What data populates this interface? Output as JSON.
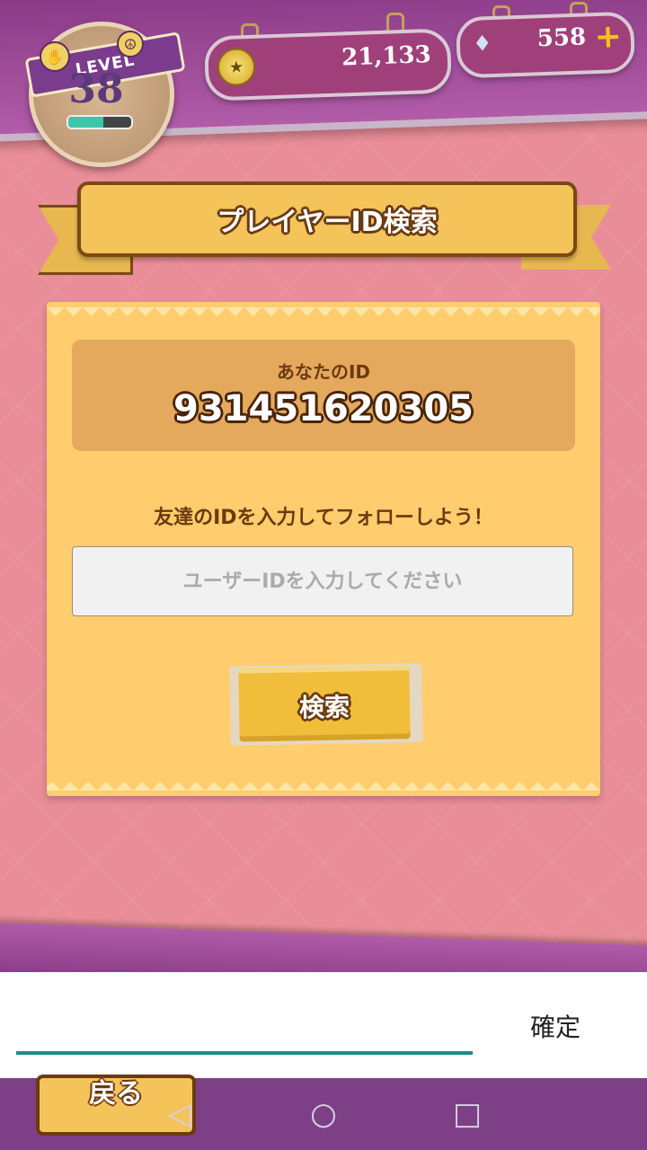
{
  "header": {
    "level_badge_text": "LEVEL",
    "level": "38",
    "level_progress": 0.55,
    "coins": "21,133",
    "gems": "558"
  },
  "banner": {
    "title": "プレイヤーID検索"
  },
  "card": {
    "id_label": "あなたのID",
    "id_value": "931451620305",
    "prompt": "友達のIDを入力してフォローしよう！",
    "input_placeholder": "ユーザーIDを入力してください",
    "input_value": "",
    "search_label": "検索"
  },
  "ime": {
    "confirm_label": "確定",
    "value": ""
  },
  "footer": {
    "back_label": "戻る"
  },
  "colors": {
    "background": "#e98d98",
    "card": "#ffcd6e",
    "accent_purple": "#8a3b86",
    "ime_underline": "#1f8a86"
  }
}
